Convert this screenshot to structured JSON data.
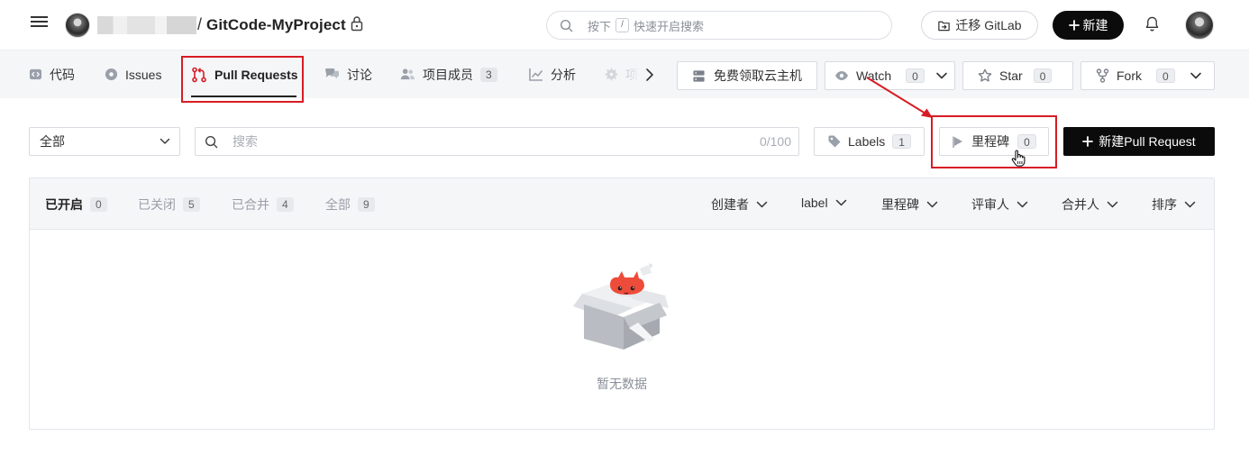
{
  "header": {
    "repo_separator": "/",
    "repo_name": "GitCode-MyProject",
    "search_placeholder_prefix": "按下",
    "search_shortcut_key": "/",
    "search_placeholder_suffix": "快速开启搜索",
    "migrate_label": "迁移 GitLab",
    "new_label": "新建"
  },
  "tabs": [
    {
      "label": "代码",
      "icon": "code-icon"
    },
    {
      "label": "Issues",
      "icon": "issues-icon"
    },
    {
      "label": "Pull Requests",
      "icon": "pull-request-icon",
      "active": true
    },
    {
      "label": "讨论",
      "icon": "discussion-icon"
    },
    {
      "label": "项目成员",
      "icon": "members-icon",
      "count": "3"
    },
    {
      "label": "分析",
      "icon": "analytics-icon"
    },
    {
      "label": "项",
      "icon": "settings-icon"
    }
  ],
  "repo_actions": {
    "free_host_label": "免费领取云主机",
    "watch_label": "Watch",
    "watch_count": "0",
    "star_label": "Star",
    "star_count": "0",
    "fork_label": "Fork",
    "fork_count": "0"
  },
  "filters": {
    "scope_selected": "全部",
    "search_placeholder": "搜索",
    "search_counter": "0/100",
    "labels_label": "Labels",
    "labels_count": "1",
    "milestone_label": "里程碑",
    "milestone_count": "0",
    "new_pr_label": "新建Pull Request"
  },
  "list": {
    "states": [
      {
        "label": "已开启",
        "count": "0",
        "active": true
      },
      {
        "label": "已关闭",
        "count": "5"
      },
      {
        "label": "已合并",
        "count": "4"
      },
      {
        "label": "全部",
        "count": "9"
      }
    ],
    "dropdowns": [
      "创建者",
      "label",
      "里程碑",
      "评审人",
      "合并人",
      "排序"
    ],
    "empty_text": "暂无数据"
  },
  "colors": {
    "highlight_red": "#d71c25",
    "primary_black": "#0b0b0b",
    "tab_bar_bg": "#f5f6f8"
  }
}
